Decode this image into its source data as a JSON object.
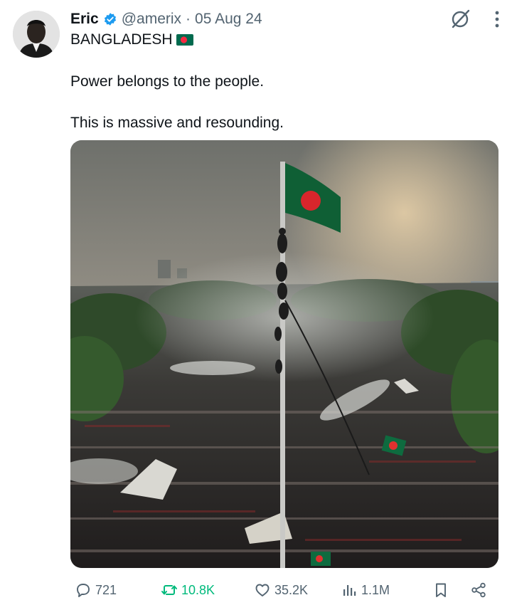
{
  "author": {
    "display_name": "Eric",
    "handle": "@amerix",
    "separator": "·",
    "date": "05 Aug 24",
    "bio": "BANGLADESH",
    "bio_flag_icon": "bangladesh-flag-icon",
    "avatar_icon": "profile-avatar",
    "verified_icon": "verified-badge-icon",
    "verified_color": "#1d9bf0"
  },
  "tweet": {
    "text": "Power belongs to the people.\n\nThis is massive and resounding.",
    "media_description_icon": "protest-crowd-flag-photo"
  },
  "header_icons": [
    "grok-icon",
    "more-vertical-icon"
  ],
  "actions": {
    "replies": "721",
    "retweets": "10.8K",
    "likes": "35.2K",
    "views": "1.1M",
    "retweet_color": "#00ba7c",
    "icons": [
      "reply-icon",
      "retweet-icon",
      "like-icon",
      "views-icon",
      "bookmark-icon",
      "share-icon"
    ]
  },
  "colors": {
    "text": "#0f1419",
    "secondary": "#536471",
    "flag_green": "#006a4e",
    "flag_red": "#f42a41"
  }
}
